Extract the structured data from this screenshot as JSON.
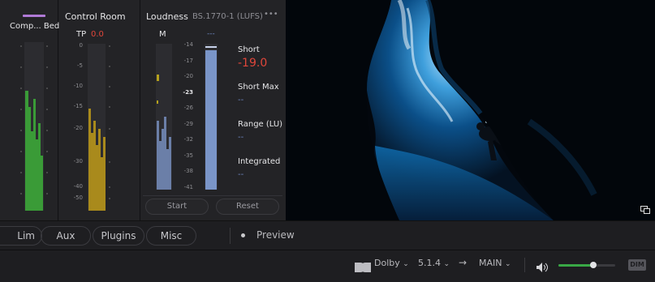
{
  "comp": {
    "label": "Comp... Bed",
    "ticks": [
      "",
      "",
      "",
      "",
      "",
      "",
      "",
      "",
      "",
      ""
    ]
  },
  "control_room": {
    "title": "Control Room",
    "tp_label": "TP",
    "tp_value": "0.0",
    "ticks": [
      "0",
      "-5",
      "-10",
      "-15",
      "-20",
      "-30",
      "-40",
      "-50"
    ]
  },
  "loudness": {
    "title": "Loudness",
    "standard": "BS.1770-1 (LUFS)",
    "menu": "•••",
    "m_label": "M",
    "m_dash": "---",
    "scale": [
      "-14",
      "-17",
      "-20",
      "-23",
      "-26",
      "-29",
      "-32",
      "-35",
      "-38",
      "-41"
    ],
    "short_label": "Short",
    "short_value": "-19.0",
    "short_max_label": "Short Max",
    "short_max_value": "--",
    "range_label": "Range (LU)",
    "range_value": "--",
    "integrated_label": "Integrated",
    "integrated_value": "--",
    "start": "Start",
    "reset": "Reset"
  },
  "tabs": [
    "Lim",
    "Aux",
    "Plugins",
    "Misc"
  ],
  "preview": "Preview",
  "bottom": {
    "dolby": "Dolby",
    "format": "5.1.4",
    "arrow": "→",
    "main": "MAIN",
    "dim": "DIM",
    "volume_level": 0.62
  },
  "colors": {
    "green": "#3a9b37",
    "yellow": "#a98a1c",
    "blue": "#7a95c8",
    "red": "#e0463a"
  }
}
